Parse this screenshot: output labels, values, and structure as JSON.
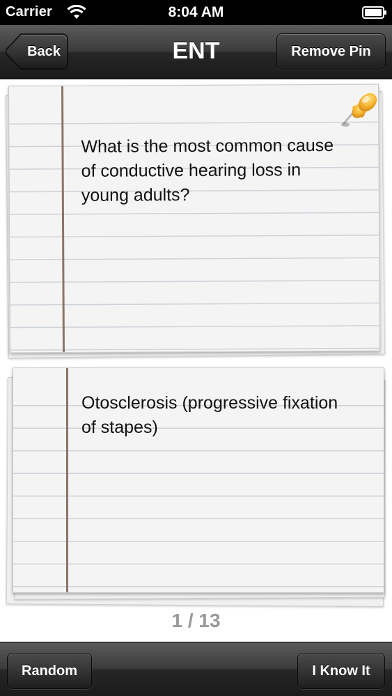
{
  "status_bar": {
    "carrier": "Carrier",
    "time": "8:04 AM",
    "wifi_icon": "wifi-icon",
    "battery_icon": "battery-icon"
  },
  "nav": {
    "back_label": "Back",
    "title": "ENT",
    "remove_pin_label": "Remove Pin"
  },
  "question_card": {
    "text": "What is the most common cause of conductive hearing loss in young adults?",
    "pinned": true,
    "pin_icon": "pushpin-icon"
  },
  "answer_card": {
    "text": "Otosclerosis (progressive fixation of stapes)"
  },
  "pagination": {
    "counter": "1 / 13"
  },
  "toolbar": {
    "random_label": "Random",
    "know_it_label": "I Know It"
  },
  "colors": {
    "bar_dark": "#1b1b1b",
    "card_paper": "#f4f4f4",
    "rule_line": "#cdd3da",
    "margin_line": "#8c7468",
    "pin": "#f5a623",
    "counter": "#9a9a9a"
  }
}
